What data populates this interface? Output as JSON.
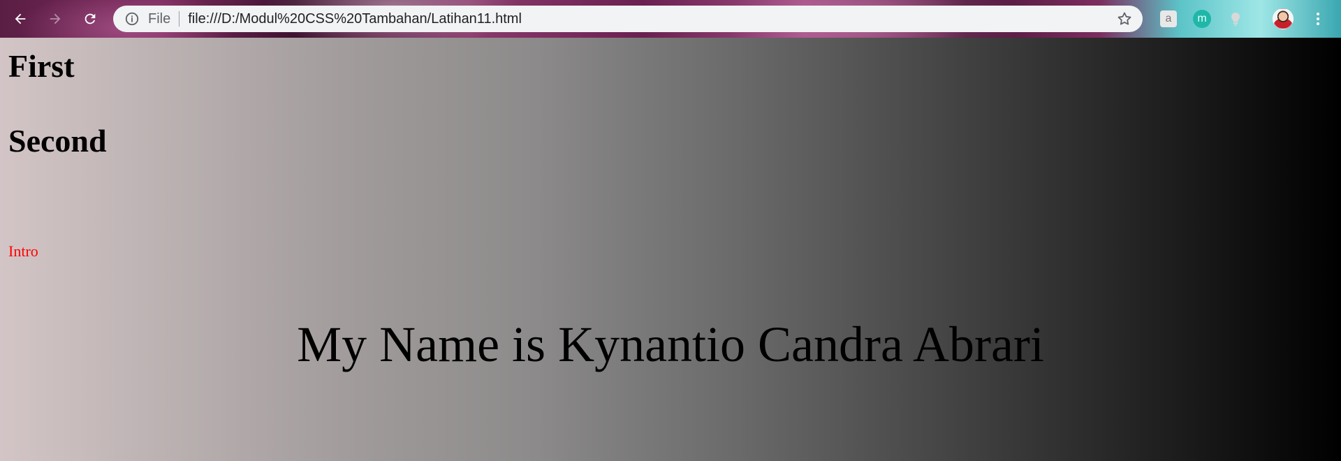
{
  "browser": {
    "omnibox": {
      "scheme_label": "File",
      "url": "file:///D:/Modul%20CSS%20Tambahan/Latihan11.html"
    },
    "icons": {
      "back": "back-arrow-icon",
      "forward": "forward-arrow-icon",
      "reload": "reload-icon",
      "info": "info-icon",
      "star": "bookmark-star-icon",
      "menu": "more-vert-icon"
    },
    "extensions": {
      "a_label": "a",
      "m_label": "m"
    }
  },
  "page": {
    "heading_first": "First",
    "heading_second": "Second",
    "intro": "Intro",
    "name_text": "My Name is Kynantio Candra Abrari",
    "colors": {
      "intro": "#ff0000",
      "gradient_start": "#d3c5c6",
      "gradient_end": "#000000"
    }
  }
}
